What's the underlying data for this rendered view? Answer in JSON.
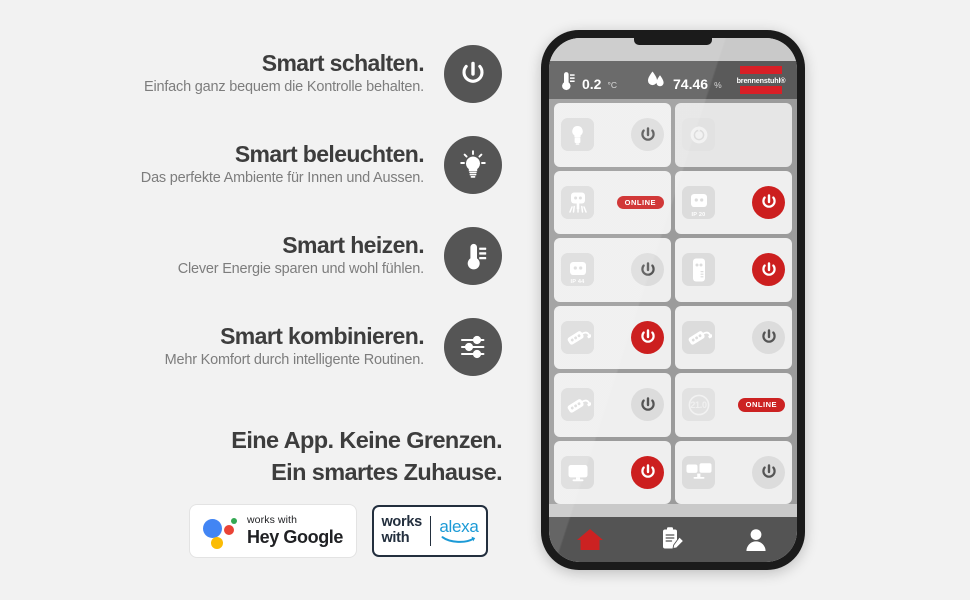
{
  "features": [
    {
      "title": "Smart schalten.",
      "subtitle": "Einfach ganz bequem die Kontrolle behalten.",
      "icon": "power-icon"
    },
    {
      "title": "Smart beleuchten.",
      "subtitle": "Das perfekte Ambiente für Innen und Aussen.",
      "icon": "lightbulb-icon"
    },
    {
      "title": "Smart heizen.",
      "subtitle": "Clever Energie sparen und wohl fühlen.",
      "icon": "thermometer-icon"
    },
    {
      "title": "Smart kombinieren.",
      "subtitle": "Mehr Komfort durch intelligente Routinen.",
      "icon": "sliders-icon"
    }
  ],
  "tagline": {
    "line1": "Eine App. Keine Grenzen.",
    "line2": "Ein smartes Zuhause."
  },
  "badges": {
    "google": {
      "works_with": "works with",
      "name": "Hey Google",
      "icon": "google-assistant-icon"
    },
    "alexa": {
      "works": "works",
      "with": "with",
      "name": "alexa",
      "icon": "amazon-alexa-icon"
    }
  },
  "phone": {
    "status_bar": {
      "temperature": {
        "icon": "thermometer-icon",
        "value": "0.2",
        "unit": "°C"
      },
      "humidity": {
        "icon": "humidity-drop-icon",
        "value": "74.46",
        "unit": "%"
      },
      "brand": "brennenstuhl®"
    },
    "tiles": [
      {
        "device_icon": "lightbulb-icon",
        "power": "off",
        "badge": null,
        "label": null
      },
      {
        "device_icon": "dimmer-dial-icon",
        "power": "none",
        "badge": null,
        "label": null
      },
      {
        "device_icon": "garden-socket-icon",
        "power": "none",
        "badge": "ONLINE",
        "label": null
      },
      {
        "device_icon": "socket-icon",
        "power": "on",
        "badge": null,
        "label": "IP 20"
      },
      {
        "device_icon": "socket-icon",
        "power": "off",
        "badge": null,
        "label": "IP 44"
      },
      {
        "device_icon": "wall-adapter-icon",
        "power": "on",
        "badge": null,
        "label": null
      },
      {
        "device_icon": "power-strip-icon",
        "power": "on",
        "badge": null,
        "label": null
      },
      {
        "device_icon": "power-strip-icon",
        "power": "off",
        "badge": null,
        "label": null
      },
      {
        "device_icon": "power-strip-icon",
        "power": "off",
        "badge": null,
        "label": null
      },
      {
        "device_icon": "thermostat-icon",
        "power": "none",
        "badge": "ONLINE",
        "label": "21.0"
      },
      {
        "device_icon": "monitor-icon",
        "power": "on",
        "badge": null,
        "label": null
      },
      {
        "device_icon": "dual-screen-icon",
        "power": "off",
        "badge": null,
        "label": null
      }
    ],
    "nav": [
      {
        "icon": "home-icon",
        "active": true
      },
      {
        "icon": "clipboard-edit-icon",
        "active": false
      },
      {
        "icon": "person-icon",
        "active": false
      }
    ]
  },
  "colors": {
    "background": "#f2f2f2",
    "icon_circle": "#555555",
    "title_text": "#3d3d3d",
    "sub_text": "#7d7d7d",
    "accent_red": "#cc1f1f",
    "brand_red": "#d81f26",
    "status_bar": "#5a5a5a",
    "nav_bar": "#545454",
    "tile_area": "#9b9b9b",
    "tile": "#efefef"
  }
}
